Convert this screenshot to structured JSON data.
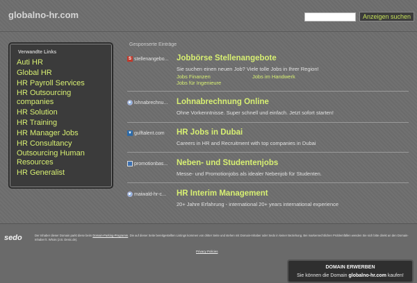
{
  "header": {
    "domain": "globalno-hr.com",
    "search_placeholder": "",
    "search_button": "Anzeigen suchen"
  },
  "sidebar": {
    "heading": "Verwandte Links",
    "links": [
      "Auti HR",
      "Global HR",
      "HR Payroll Services",
      "HR Outsourcing companies",
      "HR Solution",
      "HR Training",
      "HR Manager Jobs",
      "HR Consultancy",
      "Outsourcing Human Resources",
      "HR Generalist"
    ]
  },
  "ads": {
    "label": "Gesponserte Einträge",
    "items": [
      {
        "source": "stellenangebo...",
        "icon": "s-favicon-icon",
        "title": "Jobbörse Stellenangebote",
        "desc": "Sie suchen einen neuen Job? Viele tolle Jobs in Ihrer Region!",
        "sublinks": [
          "Jobs Finanzen",
          "Jobs im Handwerk",
          "Jobs für Ingenieure"
        ]
      },
      {
        "source": "lohnabrechnu...",
        "icon": "globe-favicon-icon",
        "title": "Lohnabrechnung Online",
        "desc": "Ohne Vorkenntnisse. Super schnell und einfach. Jetzt sofort starten!"
      },
      {
        "source": "gulftalent.com",
        "icon": "gulftalent-favicon-icon",
        "title": "HR Jobs in Dubai",
        "desc": "Careers in HR and Recruitment with top companies in Dubai"
      },
      {
        "source": "promotionbas...",
        "icon": "promotion-favicon-icon",
        "title": "Neben- und Studentenjobs",
        "desc": "Messe- und Promotionjobs als idealer Nebenjob für Studenten."
      },
      {
        "source": "maiwald-hr-c...",
        "icon": "globe-favicon-icon",
        "title": "HR Interim Management",
        "desc": "20+ Jahre Erfahrung - international 20+ years international experience"
      }
    ]
  },
  "footer": {
    "logo": "sedo",
    "text_1": "Der Inhaber dieser Domain parkt diese beim ",
    "text_link": "Domain-Parking-Programm",
    "text_2": ". Die auf dieser Seite bereitgestellten Listings kommen von dritter Seite und stehen mit Domain-Inhaber oder Sedo in keiner Beziehung. Bei markenrechtlichen Problemfällen wenden Sie sich bitte direkt an den Domain-Inhaber lt. Whois (z.B. Denic.de).",
    "privacy": "Privacy Policies"
  },
  "buy_box": {
    "title": "DOMAIN ERWERBEN",
    "text_before": "Sie können die Domain ",
    "domain": "globalno-hr.com",
    "text_after": " kaufen!"
  }
}
